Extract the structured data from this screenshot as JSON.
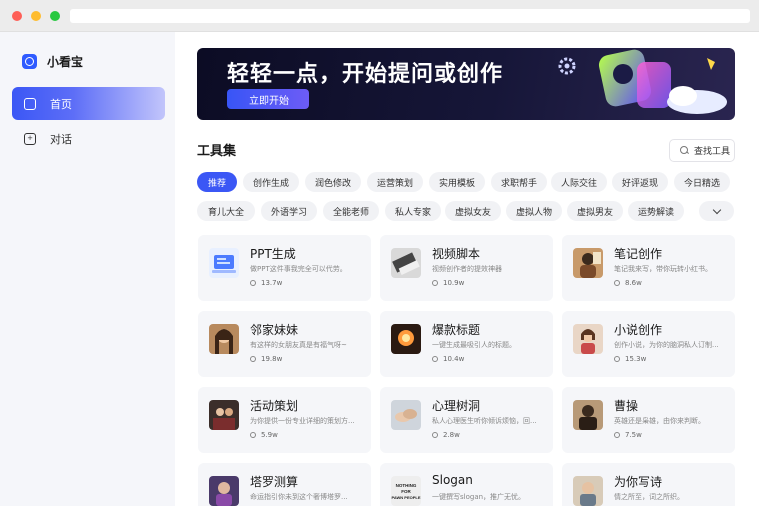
{
  "app": {
    "name": "小看宝"
  },
  "sidebar": {
    "items": [
      {
        "label": "首页",
        "icon": "home-icon"
      },
      {
        "label": "对话",
        "icon": "chat-icon"
      }
    ]
  },
  "banner": {
    "title": "轻轻一点，开始提问或创作",
    "button_label": "立即开始"
  },
  "toolset": {
    "title": "工具集",
    "search_label": "查找工具"
  },
  "tags": {
    "row1": [
      "推荐",
      "创作生成",
      "润色修改",
      "运营策划",
      "实用模板",
      "求职帮手",
      "人际交往",
      "好评返现",
      "今日精选"
    ],
    "row2": [
      "育儿大全",
      "外语学习",
      "全能老师",
      "私人专家",
      "虚拟女友",
      "虚拟人物",
      "虚拟男友",
      "运势解读"
    ],
    "active": "推荐"
  },
  "cards": [
    {
      "title": "PPT生成",
      "desc": "做PPT这件事我完全可以代劳。",
      "count": "13.7w"
    },
    {
      "title": "视频脚本",
      "desc": "视频创作者的提效神器",
      "count": "10.9w"
    },
    {
      "title": "笔记创作",
      "desc": "笔记我来写，带你玩转小红书。",
      "count": "8.6w"
    },
    {
      "title": "邻家妹妹",
      "desc": "有这样的女朋友真是有福气呀~",
      "count": "19.8w"
    },
    {
      "title": "爆款标题",
      "desc": "一键生成最吸引人的标题。",
      "count": "10.4w"
    },
    {
      "title": "小说创作",
      "desc": "创作小说，为你的脑洞私人订制...",
      "count": "15.3w"
    },
    {
      "title": "活动策划",
      "desc": "为你提供一份专业详细的策划方...",
      "count": "5.9w"
    },
    {
      "title": "心理树洞",
      "desc": "私人心理医生听你倾诉烦恼，回...",
      "count": "2.8w"
    },
    {
      "title": "曹操",
      "desc": "英雄还是枭雄，由你来判断。",
      "count": "7.5w"
    },
    {
      "title": "塔罗测算",
      "desc": "命运指引你未到这个奢博塔罗...",
      "count": ""
    },
    {
      "title": "Slogan",
      "desc": "一键撰写slogan，推广无忧。",
      "count": ""
    },
    {
      "title": "为你写诗",
      "desc": "情之所至，词之所织。",
      "count": ""
    }
  ],
  "card_thumb_overlay": {
    "slogan": "NOTHING FOR PAWN PEOPLE"
  },
  "colors": {
    "accent": "#3b57f5",
    "sidebar_bg": "#f5f6fa",
    "card_bg": "#f5f6f9",
    "banner_bg": "#0c0c24"
  }
}
